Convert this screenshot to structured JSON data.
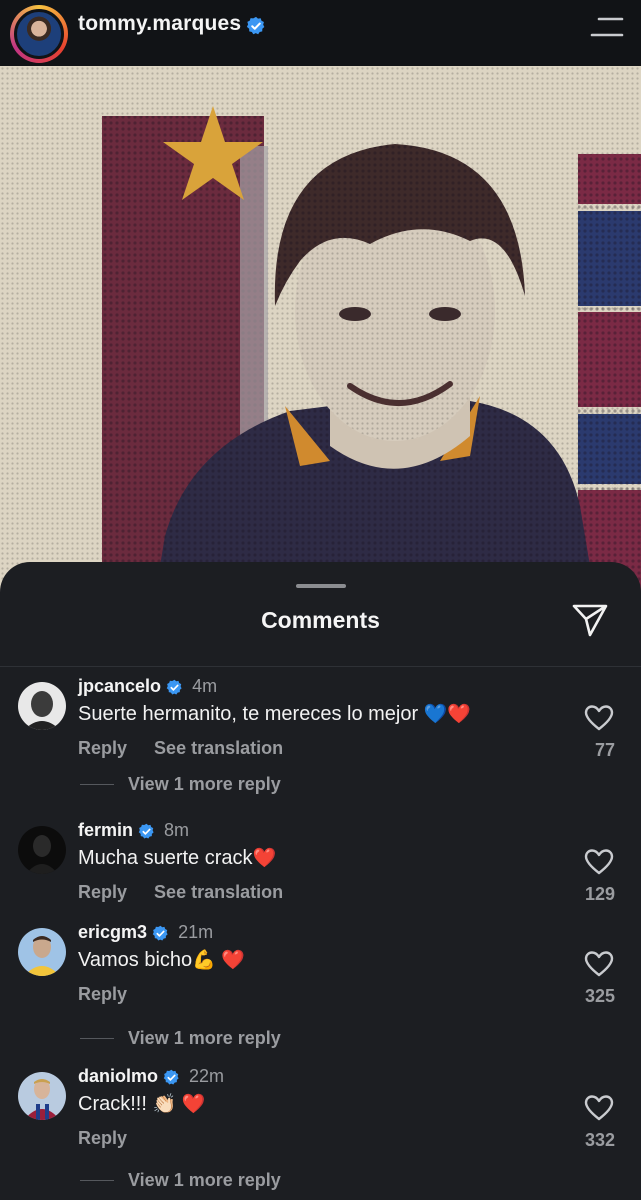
{
  "header": {
    "username": "tommy.marques",
    "verified": true
  },
  "sheet": {
    "title": "Comments"
  },
  "comments": [
    {
      "username": "jpcancelo",
      "verified": true,
      "time": "4m",
      "text": "Suerte hermanito, te mereces lo mejor",
      "emoji": [
        "💙",
        "❤️"
      ],
      "reply_label": "Reply",
      "translate_label": "See translation",
      "likes": "77",
      "view_more": "View 1 more reply"
    },
    {
      "username": "fermin",
      "verified": true,
      "time": "8m",
      "text": "Mucha suerte crack",
      "emoji": [
        "❤️"
      ],
      "reply_label": "Reply",
      "translate_label": "See translation",
      "likes": "129"
    },
    {
      "username": "ericgm3",
      "verified": true,
      "time": "21m",
      "text": "Vamos bicho",
      "emoji": [
        "💪",
        "❤️"
      ],
      "reply_label": "Reply",
      "likes": "325",
      "view_more": "View 1 more reply"
    },
    {
      "username": "daniolmo",
      "verified": true,
      "time": "22m",
      "text": "Crack!!!",
      "emoji": [
        "👏🏻",
        "❤️"
      ],
      "reply_label": "Reply",
      "likes": "332",
      "view_more": "View 1 more reply"
    }
  ],
  "colors": {
    "background": "#1c1e22",
    "header_bg": "#111316",
    "verified_blue": "#3b97f3",
    "muted_text": "#9a9ca0",
    "heart_red": "#e8202e"
  }
}
